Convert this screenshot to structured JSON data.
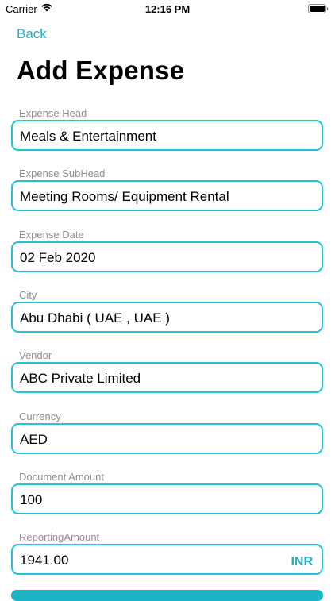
{
  "status_bar": {
    "carrier": "Carrier",
    "time": "12:16 PM",
    "wifi_icon": "wifi-icon",
    "battery_icon": "battery-icon"
  },
  "nav": {
    "back_label": "Back"
  },
  "page": {
    "title": "Add Expense"
  },
  "form": {
    "fields": [
      {
        "label": "Expense Head",
        "value": "Meals & Entertainment"
      },
      {
        "label": "Expense SubHead",
        "value": "Meeting Rooms/ Equipment Rental"
      },
      {
        "label": "Expense Date",
        "value": "02 Feb 2020"
      },
      {
        "label": "City",
        "value": "Abu Dhabi ( UAE , UAE )"
      },
      {
        "label": "Vendor",
        "value": "ABC Private Limited"
      },
      {
        "label": "Currency",
        "value": "AED"
      },
      {
        "label": "Document Amount",
        "value": "100"
      },
      {
        "label": "ReportingAmount",
        "value": "1941.00",
        "suffix": "INR"
      }
    ]
  },
  "colors": {
    "accent": "#1bb3c6",
    "border": "#22c4d6",
    "label": "#8e8e93"
  }
}
